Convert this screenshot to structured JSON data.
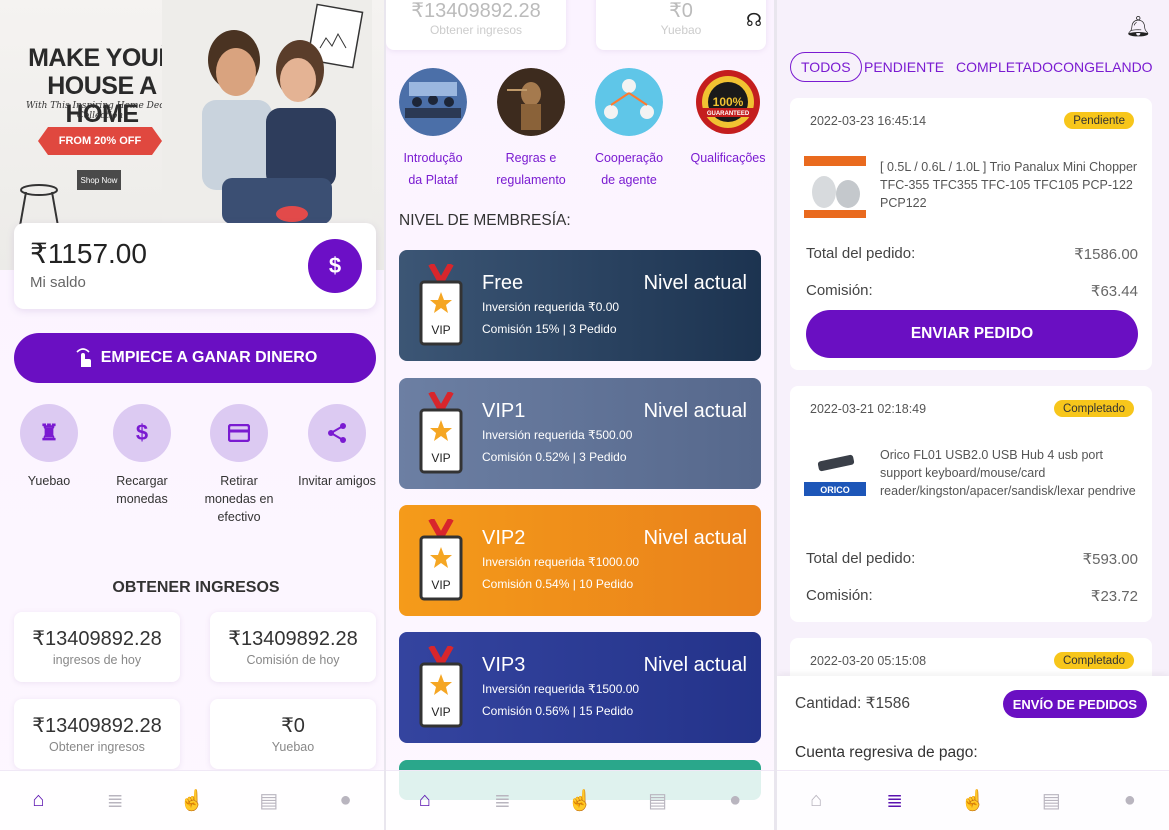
{
  "panel1": {
    "banner": {
      "title": "MAKE YOUR HOUSE A HOME",
      "subtitle": "With This Inspiring Home Decor Collection",
      "offer": "FROM 20% OFF",
      "shop": "Shop Now"
    },
    "balance": {
      "amount": "₹1157.00",
      "label": "Mi saldo",
      "button": "$"
    },
    "earn_button": "EMPIECE A GANAR DINERO",
    "quick_actions": [
      {
        "label": "Yuebao",
        "icon": "piggy-bank-icon"
      },
      {
        "label": "Recargar monedas",
        "icon": "dollar-coin-icon"
      },
      {
        "label": "Retirar monedas en efectivo",
        "icon": "credit-card-icon"
      },
      {
        "label": "Invitar amigos",
        "icon": "share-icon"
      }
    ],
    "section_title": "OBTENER INGRESOS",
    "stats": [
      {
        "value": "₹13409892.28",
        "label": "ingresos de hoy"
      },
      {
        "value": "₹13409892.28",
        "label": "Comisión de hoy"
      },
      {
        "value": "₹13409892.28",
        "label": "Obtener ingresos"
      },
      {
        "value": "₹0",
        "label": "Yuebao"
      }
    ]
  },
  "panel2": {
    "top_stats": [
      {
        "value": "₹13409892.28",
        "label": "Obtener ingresos"
      },
      {
        "value": "₹0",
        "label": "Yuebao"
      }
    ],
    "info_items": [
      {
        "line1": "Introdução",
        "line2": "da Plataf"
      },
      {
        "line1": "Regras e",
        "line2": "regulamento"
      },
      {
        "line1": "Cooperação",
        "line2": "de agente"
      },
      {
        "line1": "Qualificações",
        "line2": ""
      }
    ],
    "guarantee_text": "100%",
    "guarantee_sub": "GUARANTEED",
    "member_title": "NIVEL DE MEMBRESÍA:",
    "levels": [
      {
        "name": "Free",
        "status": "Nivel actual",
        "investment": "Inversión requerida ₹0.00",
        "commission": "Comisión 15% | 3 Pedido",
        "color": "#22405f"
      },
      {
        "name": "VIP1",
        "status": "Nivel actual",
        "investment": "Inversión requerida ₹500.00",
        "commission": "Comisión 0.52% | 3 Pedido",
        "color": "#5a6f96"
      },
      {
        "name": "VIP2",
        "status": "Nivel actual",
        "investment": "Inversión requerida ₹1000.00",
        "commission": "Comisión 0.54% | 10 Pedido",
        "color": "#f08a16"
      },
      {
        "name": "VIP3",
        "status": "Nivel actual",
        "investment": "Inversión requerida ₹1500.00",
        "commission": "Comisión 0.56% | 15 Pedido",
        "color": "#2f3b9a"
      }
    ],
    "vip_badge_text": "VIP"
  },
  "panel3": {
    "filters": [
      "TODOS",
      "PENDIENTE",
      "COMPLETADO",
      "CONGELANDO"
    ],
    "orders": [
      {
        "date": "2022-03-23 16:45:14",
        "status": "Pendiente",
        "product": "[ 0.5L / 0.6L / 1.0L ] Trio Panalux Mini Chopper TFC-355 TFC355 TFC-105 TFC105 PCP-122 PCP122",
        "total_label": "Total del pedido:",
        "total": "₹1586.00",
        "commission_label": "Comisión:",
        "commission": "₹63.44",
        "button": "ENVIAR PEDIDO"
      },
      {
        "date": "2022-03-21 02:18:49",
        "status": "Completado",
        "product": "Orico FL01 USB2.0 USB Hub 4 usb port support keyboard/mouse/card reader/kingston/apacer/sandisk/lexar pendrive",
        "total_label": "Total del pedido:",
        "total": "₹593.00",
        "commission_label": "Comisión:",
        "commission": "₹23.72",
        "brand": "ORICO"
      },
      {
        "date": "2022-03-20 05:15:08",
        "status": "Completado"
      }
    ],
    "quantity": "Cantidad: ₹1586",
    "submit_button": "ENVÍO DE PEDIDOS",
    "countdown": "Cuenta regresiva de pago:"
  },
  "tabbar_icons": [
    "home-icon",
    "orders-icon",
    "grab-icon",
    "message-icon",
    "profile-icon"
  ],
  "colors": {
    "accent": "#6a0fc2",
    "accent_light": "#dccaf2",
    "pill": "#f7c61b"
  }
}
